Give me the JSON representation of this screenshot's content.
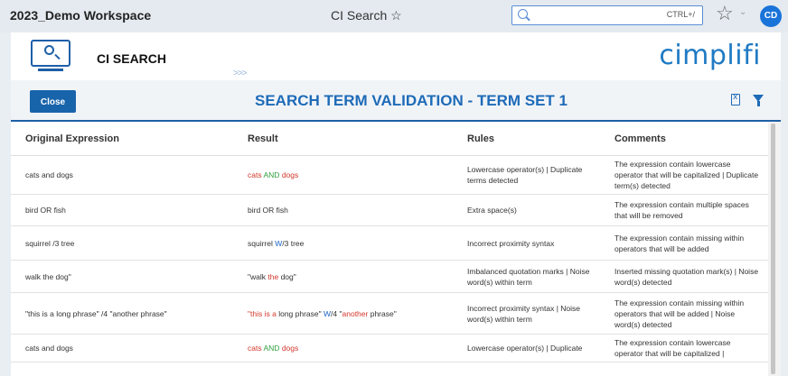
{
  "window": {
    "workspace_title": "2023_Demo Workspace",
    "page_title": "CI Search ☆",
    "search_shortcut": "CTRL+/",
    "avatar_initials": "CD"
  },
  "app": {
    "name": "CI SEARCH",
    "brand": "cimplifi"
  },
  "toolbar": {
    "close_label": "Close",
    "report_title": "SEARCH TERM VALIDATION - TERM SET 1"
  },
  "table": {
    "headers": [
      "Original Expression",
      "Result",
      "Rules",
      "Comments"
    ],
    "rows": [
      {
        "original": "cats and dogs",
        "result": [
          {
            "t": "cats",
            "c": "red"
          },
          {
            "t": " "
          },
          {
            "t": "AND",
            "c": "green"
          },
          {
            "t": " "
          },
          {
            "t": "dogs",
            "c": "red"
          }
        ],
        "rules": "Lowercase operator(s) | Duplicate terms detected",
        "comments": "The expression contain lowercase operator that will be capitalized | Duplicate term(s) detected"
      },
      {
        "original": "bird  OR fish",
        "result": [
          {
            "t": "bird OR fish"
          }
        ],
        "rules": "Extra space(s)",
        "comments": "The expression contain multiple spaces that will be removed"
      },
      {
        "original": "squirrel /3 tree",
        "result": [
          {
            "t": "squirrel "
          },
          {
            "t": "W",
            "c": "blue"
          },
          {
            "t": "/3 tree"
          }
        ],
        "rules": "Incorrect proximity syntax",
        "comments": "The expression contain missing within operators that will be added"
      },
      {
        "original": "walk the dog\"",
        "result": [
          {
            "t": "\"walk "
          },
          {
            "t": "the",
            "c": "red"
          },
          {
            "t": " dog\""
          }
        ],
        "rules": "Imbalanced quotation marks | Noise word(s) within term",
        "comments": "Inserted missing quotation mark(s) | Noise word(s) detected"
      },
      {
        "original": "\"this is a long phrase\" /4 \"another phrase\"",
        "result": [
          {
            "t": "\"this is a",
            "c": "red"
          },
          {
            "t": " long phrase\" "
          },
          {
            "t": "W",
            "c": "blue"
          },
          {
            "t": "/4 \""
          },
          {
            "t": "another",
            "c": "red"
          },
          {
            "t": " phrase\""
          }
        ],
        "rules": "Incorrect proximity syntax | Noise word(s) within term",
        "comments": "The expression contain missing within operators that will be added | Noise word(s) detected"
      },
      {
        "original": "cats and dogs",
        "result": [
          {
            "t": "cats",
            "c": "red"
          },
          {
            "t": " "
          },
          {
            "t": "AND",
            "c": "green"
          },
          {
            "t": " "
          },
          {
            "t": "dogs",
            "c": "red"
          }
        ],
        "rules": "Lowercase operator(s) | Duplicate",
        "comments": "The expression contain lowercase operator that will be capitalized |"
      }
    ]
  },
  "colors": {
    "accent": "#1e6bb8",
    "brand": "#1f7ac4",
    "highlight_red": "#d2372b",
    "highlight_blue": "#1a63c4",
    "highlight_green": "#2e9e3d"
  }
}
